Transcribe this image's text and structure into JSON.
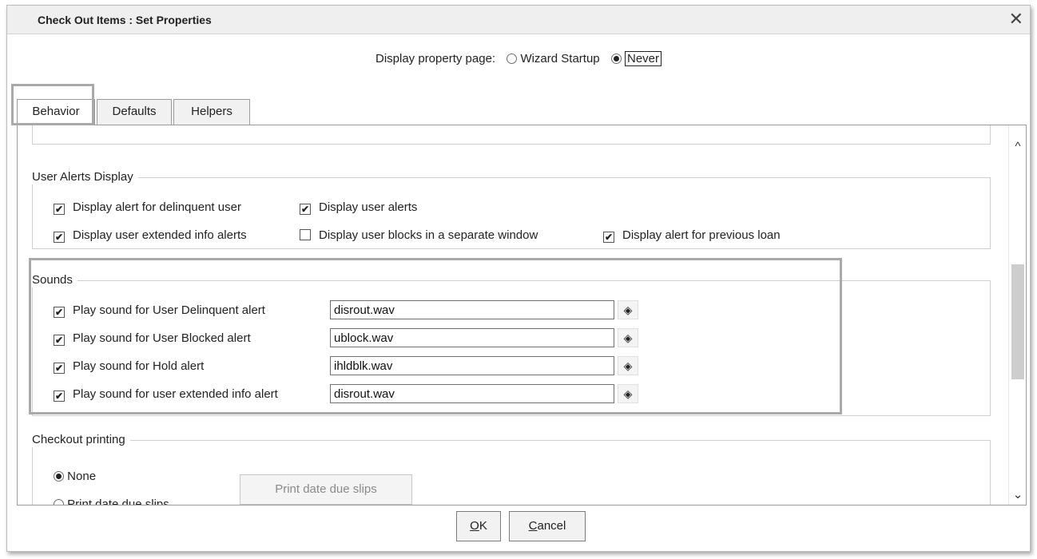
{
  "window": {
    "title": "Check Out Items : Set Properties",
    "close_glyph": "✕"
  },
  "display_property": {
    "label": "Display property page:",
    "options": [
      {
        "label": "Wizard Startup",
        "checked": false
      },
      {
        "label": "Never",
        "checked": true
      }
    ]
  },
  "tabs": [
    {
      "label": "Behavior",
      "active": true
    },
    {
      "label": "Defaults",
      "active": false
    },
    {
      "label": "Helpers",
      "active": false
    }
  ],
  "user_alerts": {
    "legend": "User Alerts Display",
    "items": [
      {
        "label": "Display alert for delinquent user",
        "checked": true
      },
      {
        "label": "Display user alerts",
        "checked": true
      },
      {
        "label": "Display user extended info alerts",
        "checked": true
      },
      {
        "label": "Display user blocks in a separate window",
        "checked": false
      },
      {
        "label": "Display alert for previous loan",
        "checked": true
      }
    ]
  },
  "sounds": {
    "legend": "Sounds",
    "items": [
      {
        "label": "Play sound for User Delinquent alert",
        "checked": true,
        "file": "disrout.wav"
      },
      {
        "label": "Play sound for User Blocked alert",
        "checked": true,
        "file": "ublock.wav"
      },
      {
        "label": "Play sound for Hold alert",
        "checked": true,
        "file": "ihldblk.wav"
      },
      {
        "label": "Play sound for user extended info alert",
        "checked": true,
        "file": "disrout.wav"
      }
    ]
  },
  "checkout_printing": {
    "legend": "Checkout printing",
    "options": [
      {
        "label": "None",
        "checked": true
      },
      {
        "label": "Print date due slips",
        "checked": false
      }
    ],
    "print_button": "Print date due slips"
  },
  "footer": {
    "ok_underline": "O",
    "ok_rest": "K",
    "cancel_underline": "C",
    "cancel_rest": "ancel"
  },
  "icons": {
    "checkmark": "✔",
    "browse": "◈",
    "scroll_up": "^",
    "scroll_down": "⌄"
  }
}
